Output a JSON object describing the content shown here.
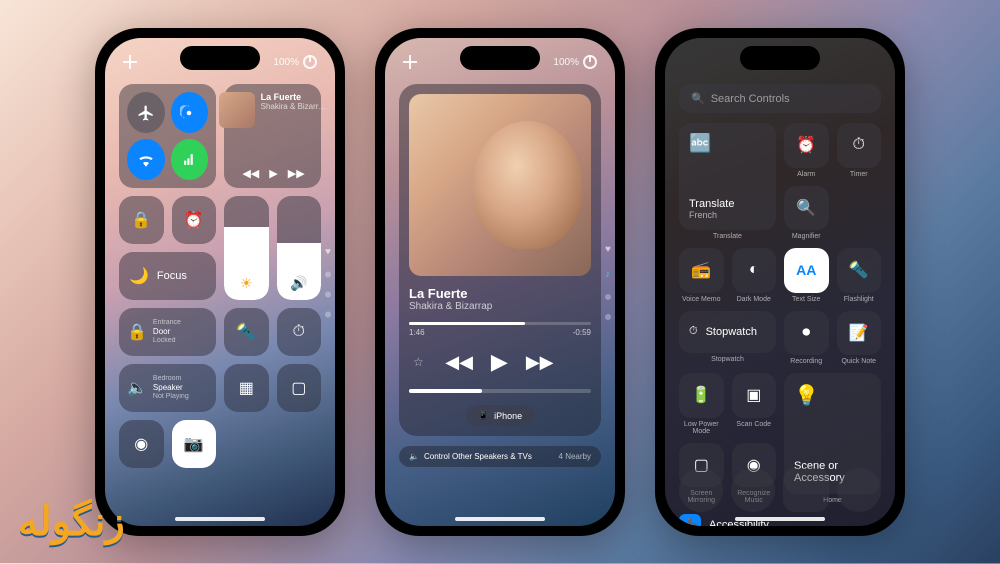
{
  "watermark": "زنگوله",
  "phone1": {
    "battery": "100%",
    "music": {
      "title": "La Fuerte",
      "artist": "Shakira & Bizarr…"
    },
    "focus_label": "Focus",
    "brightness_pct": 70,
    "volume_pct": 55,
    "lock1": {
      "room": "Entrance",
      "name": "Door",
      "state": "Locked"
    },
    "speaker": {
      "room": "Bedroom",
      "name": "Speaker",
      "state": "Not Playing"
    }
  },
  "phone2": {
    "battery": "100%",
    "track": {
      "title": "La Fuerte",
      "artist": "Shakira & Bizarrap",
      "elapsed": "1:46",
      "remaining": "-0:59",
      "progress_pct": 64
    },
    "device": "iPhone",
    "other_speakers": "Control Other Speakers & TVs",
    "nearby": "4 Nearby"
  },
  "phone3": {
    "search_placeholder": "Search Controls",
    "translate": {
      "title": "Translate",
      "sub": "French",
      "label": "Translate"
    },
    "tiles": {
      "alarm": "Alarm",
      "timer": "Timer",
      "magnifier": "Magnifier",
      "voicememo": "Voice Memo",
      "darkmode": "Dark Mode",
      "textsize": "Text Size",
      "textsize_glyph": "AA",
      "flashlight": "Flashlight",
      "stopwatch": "Stopwatch",
      "stopwatch_btn": "Stopwatch",
      "recording": "Recording",
      "quicknote": "Quick Note",
      "lowpower": "Low Power Mode",
      "scancode": "Scan Code",
      "screenmirror": "Screen Mirroring",
      "recognize": "Recognize Music",
      "home_tile": "Scene or Accessory",
      "home_label": "Home"
    },
    "accessibility": "Accessibility"
  }
}
